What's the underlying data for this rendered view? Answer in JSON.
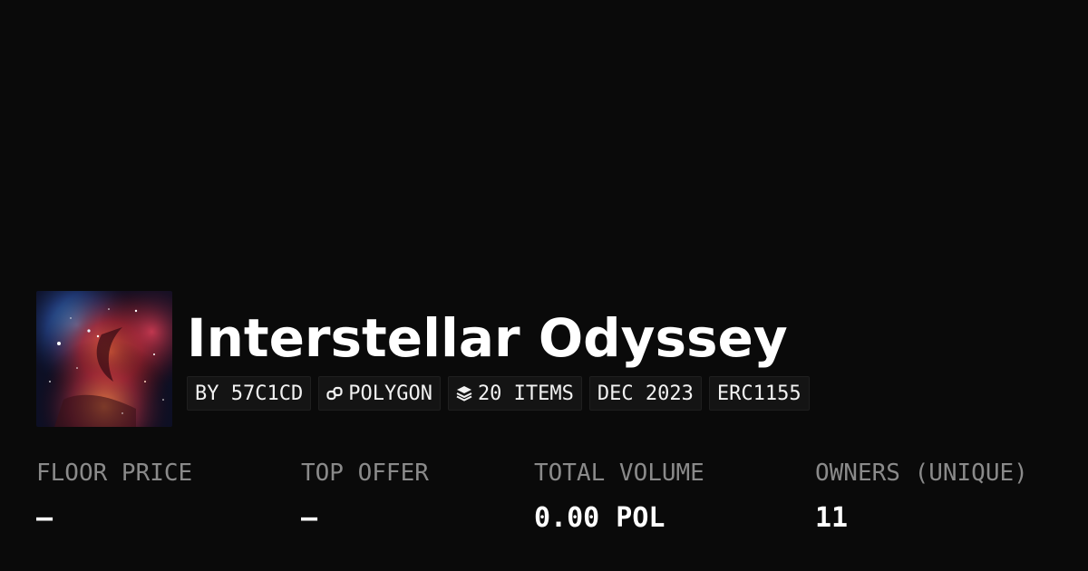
{
  "collection": {
    "title": "Interstellar Odyssey",
    "chips": {
      "creator": "BY 57C1CD",
      "chain": "POLYGON",
      "items": "20 ITEMS",
      "date": "DEC 2023",
      "standard": "ERC1155"
    },
    "chip_icons": {
      "chain": "link-icon",
      "items": "layers-icon"
    }
  },
  "stats": {
    "floor_price": {
      "label": "FLOOR PRICE",
      "value": "—"
    },
    "top_offer": {
      "label": "TOP OFFER",
      "value": "—"
    },
    "total_volume": {
      "label": "TOTAL VOLUME",
      "value": "0.00 POL"
    },
    "owners": {
      "label": "OWNERS (UNIQUE)",
      "value": "11"
    }
  },
  "colors": {
    "background": "#0a0a0a",
    "text": "#ffffff",
    "label": "#8a8a8a",
    "chip_bg": "#141414"
  }
}
